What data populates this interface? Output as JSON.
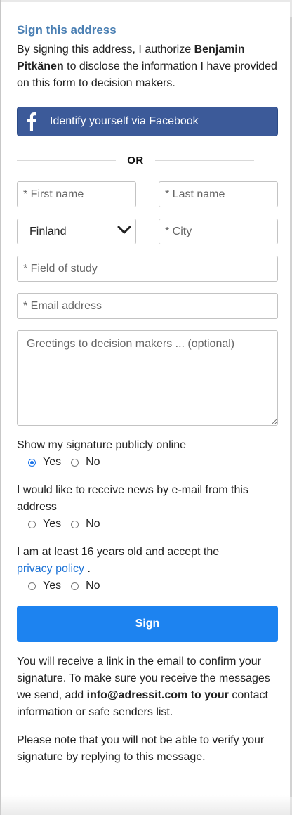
{
  "section": {
    "title": "Sign this address",
    "intro_prefix": "By signing this address, I authorize ",
    "intro_name": "Benjamin Pitkänen",
    "intro_suffix": " to disclose the information I have provided on this form to decision makers."
  },
  "facebook": {
    "label": "Identify yourself via Facebook",
    "icon": "facebook-f-icon"
  },
  "divider": {
    "or": "OR"
  },
  "form": {
    "first_name_placeholder": "* First name",
    "last_name_placeholder": "* Last name",
    "country_selected": "Finland",
    "city_placeholder": "* City",
    "field_of_study_placeholder": "* Field of study",
    "email_placeholder": "* Email address",
    "greetings_placeholder": "Greetings to decision makers ... (optional)"
  },
  "questions": {
    "show_signature": {
      "label": "Show my signature publicly online",
      "yes": "Yes",
      "no": "No",
      "selected": "Yes"
    },
    "news": {
      "label": "I would like to receive news by e-mail from this address",
      "yes": "Yes",
      "no": "No",
      "selected": ""
    },
    "age": {
      "label_prefix": "I am at least 16 years old and accept the",
      "link": "privacy policy",
      "label_suffix": " .",
      "yes": "Yes",
      "no": "No",
      "selected": ""
    }
  },
  "sign_button": "Sign",
  "notes": {
    "confirm_prefix": "You will receive a link in the email to confirm your signature. To make sure you receive the messages we send, add ",
    "confirm_bold": "info@adressit.com to your",
    "confirm_suffix": " contact information or safe senders list.",
    "reply_note": "Please note that you will not be able to verify your signature by replying to this message."
  },
  "colors": {
    "accent": "#1d83f0",
    "facebook": "#3c5a99",
    "title": "#4a7fb3",
    "link": "#1d73d6"
  }
}
